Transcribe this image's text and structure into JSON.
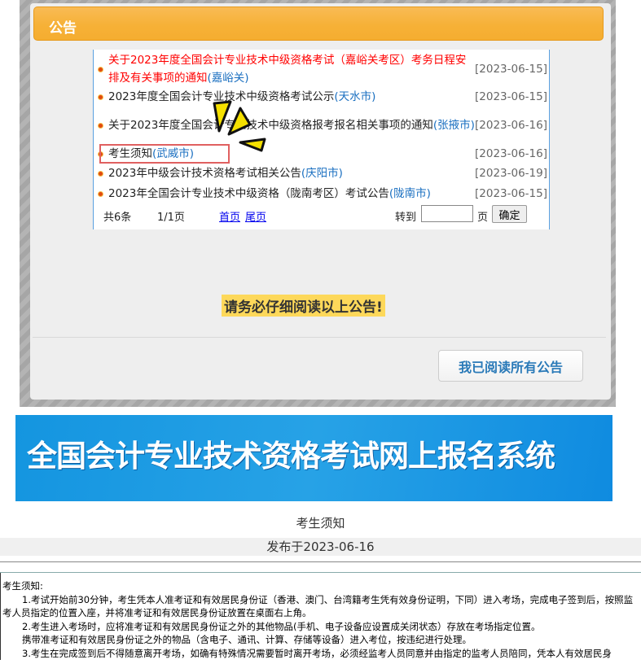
{
  "panel": {
    "title": "公告"
  },
  "announcements": [
    {
      "title": "关于2023年度全国会计专业技术中级资格考试（嘉峪关考区）考务日程安排及有关事项的通知",
      "city": "(嘉峪关)",
      "date": "[2023-06-15]",
      "highlight": true
    },
    {
      "title": "2023年度全国会计专业技术中级资格考试公示",
      "city": "(天水市)",
      "date": "[2023-06-15]"
    },
    {
      "title": "关于2023年度全国会计专业技术中级资格报考报名相关事项的通知",
      "city": "(张掖市)",
      "date": "[2023-06-16]"
    },
    {
      "title": "考生须知",
      "city": "(武威市)",
      "date": "[2023-06-16]",
      "selected": true
    },
    {
      "title": "2023年中级会计技术资格考试相关公告",
      "city": "(庆阳市)",
      "date": "[2023-06-19]"
    },
    {
      "title": "2023年全国会计专业技术中级资格（陇南考区）考试公告",
      "city": "(陇南市)",
      "date": "[2023-06-15]"
    }
  ],
  "pager": {
    "total": "共6条",
    "page": "1/1页",
    "first": "首页",
    "last": "尾页",
    "goto": "转到",
    "goto_value": "",
    "page_unit": "页",
    "confirm": "确定"
  },
  "notice": "请务必仔细阅读以上公告!",
  "read_button": "我已阅读所有公告",
  "banner": "全国会计专业技术资格考试网上报名系统",
  "article": {
    "title": "考生须知",
    "published": "发布于2023-06-16",
    "paragraphs": [
      "考生须知:",
      "1.考试开始前30分钟，考生凭本人准考证和有效居民身份证（香港、澳门、台湾籍考生凭有效身份证明，下同）进入考场，完成电子签到后，按照监考人员指定的位置入座，并将准考证和有效居民身份证放置在桌面右上角。",
      "2.考生进入考场时，应将准考证和有效居民身份证之外的其他物品(手机、电子设备应设置成关闭状态）存放在考场指定位置。",
      "携带准考证和有效居民身份证之外的物品（含电子、通讯、计算、存储等设备）进入考位，按违纪进行处理。",
      "3.考生在完成签到后不得随意离开考场，如确有特殊情况需要暂时离开考场，必须经监考人员同意并由指定的监考人员陪同，凭本人有效居民身"
    ]
  }
}
